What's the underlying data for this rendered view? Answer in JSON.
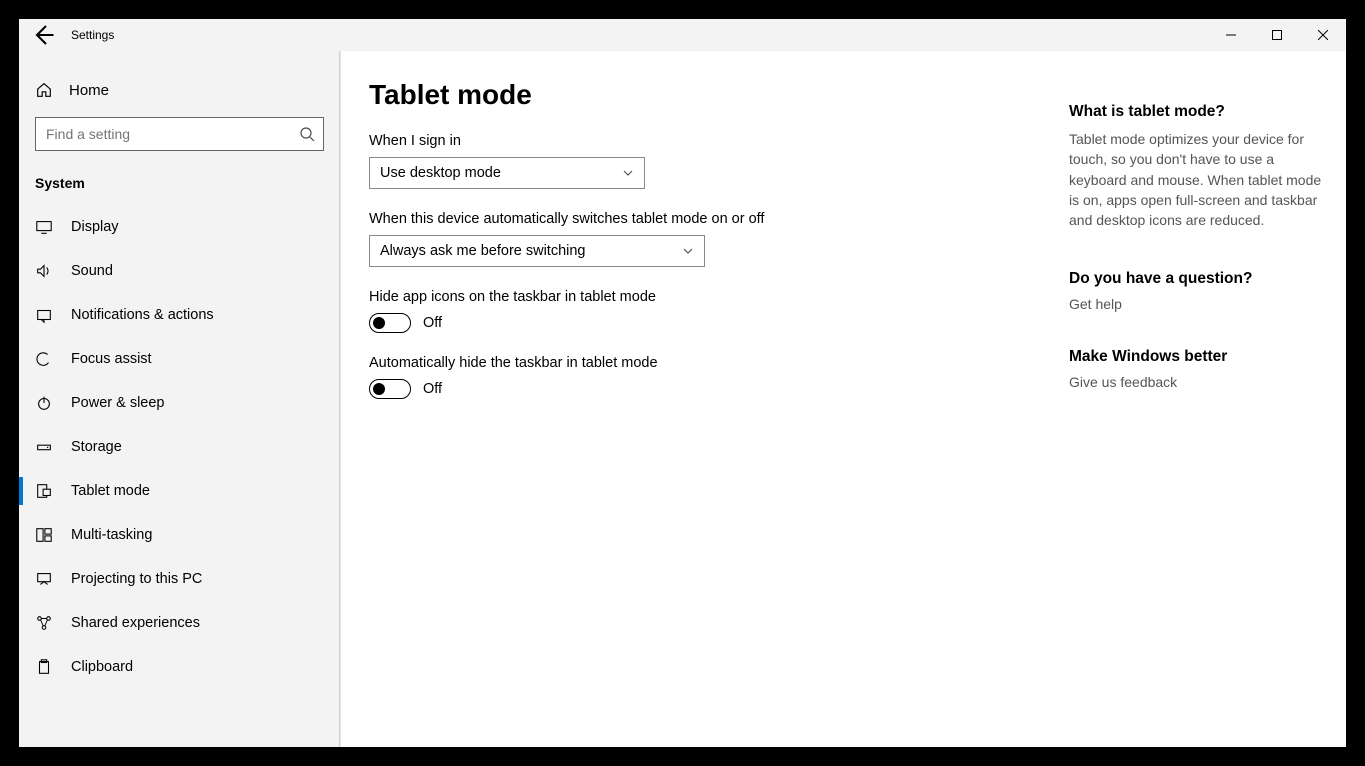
{
  "titlebar": {
    "title": "Settings"
  },
  "sidebar": {
    "home": "Home",
    "search_placeholder": "Find a setting",
    "section": "System",
    "items": [
      {
        "label": "Display"
      },
      {
        "label": "Sound"
      },
      {
        "label": "Notifications & actions"
      },
      {
        "label": "Focus assist"
      },
      {
        "label": "Power & sleep"
      },
      {
        "label": "Storage"
      },
      {
        "label": "Tablet mode",
        "active": true
      },
      {
        "label": "Multi-tasking"
      },
      {
        "label": "Projecting to this PC"
      },
      {
        "label": "Shared experiences"
      },
      {
        "label": "Clipboard"
      }
    ]
  },
  "main": {
    "title": "Tablet mode",
    "signin_label": "When I sign in",
    "signin_value": "Use desktop mode",
    "autoswitch_label": "When this device automatically switches tablet mode on or off",
    "autoswitch_value": "Always ask me before switching",
    "hide_icons_label": "Hide app icons on the taskbar in tablet mode",
    "hide_icons_state": "Off",
    "hide_taskbar_label": "Automatically hide the taskbar in tablet mode",
    "hide_taskbar_state": "Off"
  },
  "aside": {
    "what_title": "What is tablet mode?",
    "what_body": "Tablet mode optimizes your device for touch, so you don't have to use a keyboard and mouse. When tablet mode is on, apps open full-screen and taskbar and desktop icons are reduced.",
    "question_title": "Do you have a question?",
    "get_help": "Get help",
    "better_title": "Make Windows better",
    "feedback": "Give us feedback"
  }
}
